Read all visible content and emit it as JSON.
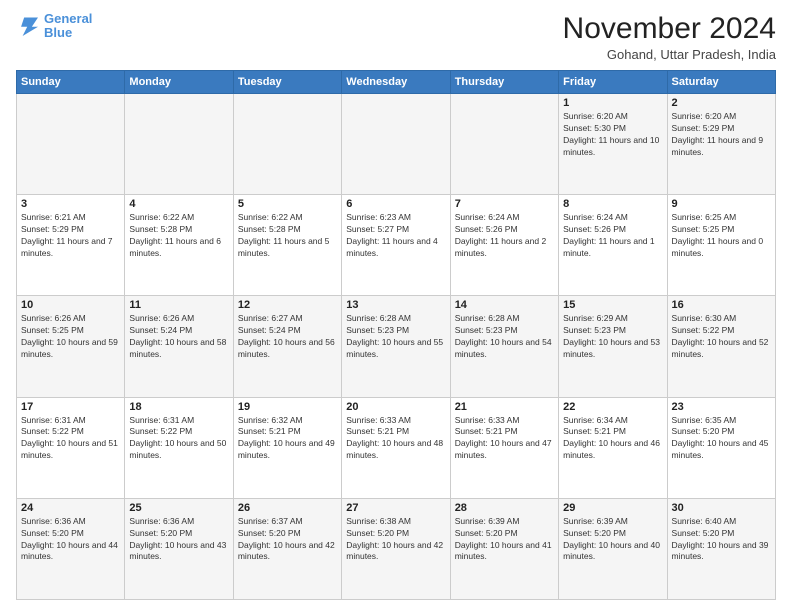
{
  "header": {
    "logo": {
      "line1": "General",
      "line2": "Blue"
    },
    "title": "November 2024",
    "location": "Gohand, Uttar Pradesh, India"
  },
  "days_of_week": [
    "Sunday",
    "Monday",
    "Tuesday",
    "Wednesday",
    "Thursday",
    "Friday",
    "Saturday"
  ],
  "weeks": [
    [
      {
        "day": "",
        "info": ""
      },
      {
        "day": "",
        "info": ""
      },
      {
        "day": "",
        "info": ""
      },
      {
        "day": "",
        "info": ""
      },
      {
        "day": "",
        "info": ""
      },
      {
        "day": "1",
        "info": "Sunrise: 6:20 AM\nSunset: 5:30 PM\nDaylight: 11 hours and 10 minutes."
      },
      {
        "day": "2",
        "info": "Sunrise: 6:20 AM\nSunset: 5:29 PM\nDaylight: 11 hours and 9 minutes."
      }
    ],
    [
      {
        "day": "3",
        "info": "Sunrise: 6:21 AM\nSunset: 5:29 PM\nDaylight: 11 hours and 7 minutes."
      },
      {
        "day": "4",
        "info": "Sunrise: 6:22 AM\nSunset: 5:28 PM\nDaylight: 11 hours and 6 minutes."
      },
      {
        "day": "5",
        "info": "Sunrise: 6:22 AM\nSunset: 5:28 PM\nDaylight: 11 hours and 5 minutes."
      },
      {
        "day": "6",
        "info": "Sunrise: 6:23 AM\nSunset: 5:27 PM\nDaylight: 11 hours and 4 minutes."
      },
      {
        "day": "7",
        "info": "Sunrise: 6:24 AM\nSunset: 5:26 PM\nDaylight: 11 hours and 2 minutes."
      },
      {
        "day": "8",
        "info": "Sunrise: 6:24 AM\nSunset: 5:26 PM\nDaylight: 11 hours and 1 minute."
      },
      {
        "day": "9",
        "info": "Sunrise: 6:25 AM\nSunset: 5:25 PM\nDaylight: 11 hours and 0 minutes."
      }
    ],
    [
      {
        "day": "10",
        "info": "Sunrise: 6:26 AM\nSunset: 5:25 PM\nDaylight: 10 hours and 59 minutes."
      },
      {
        "day": "11",
        "info": "Sunrise: 6:26 AM\nSunset: 5:24 PM\nDaylight: 10 hours and 58 minutes."
      },
      {
        "day": "12",
        "info": "Sunrise: 6:27 AM\nSunset: 5:24 PM\nDaylight: 10 hours and 56 minutes."
      },
      {
        "day": "13",
        "info": "Sunrise: 6:28 AM\nSunset: 5:23 PM\nDaylight: 10 hours and 55 minutes."
      },
      {
        "day": "14",
        "info": "Sunrise: 6:28 AM\nSunset: 5:23 PM\nDaylight: 10 hours and 54 minutes."
      },
      {
        "day": "15",
        "info": "Sunrise: 6:29 AM\nSunset: 5:23 PM\nDaylight: 10 hours and 53 minutes."
      },
      {
        "day": "16",
        "info": "Sunrise: 6:30 AM\nSunset: 5:22 PM\nDaylight: 10 hours and 52 minutes."
      }
    ],
    [
      {
        "day": "17",
        "info": "Sunrise: 6:31 AM\nSunset: 5:22 PM\nDaylight: 10 hours and 51 minutes."
      },
      {
        "day": "18",
        "info": "Sunrise: 6:31 AM\nSunset: 5:22 PM\nDaylight: 10 hours and 50 minutes."
      },
      {
        "day": "19",
        "info": "Sunrise: 6:32 AM\nSunset: 5:21 PM\nDaylight: 10 hours and 49 minutes."
      },
      {
        "day": "20",
        "info": "Sunrise: 6:33 AM\nSunset: 5:21 PM\nDaylight: 10 hours and 48 minutes."
      },
      {
        "day": "21",
        "info": "Sunrise: 6:33 AM\nSunset: 5:21 PM\nDaylight: 10 hours and 47 minutes."
      },
      {
        "day": "22",
        "info": "Sunrise: 6:34 AM\nSunset: 5:21 PM\nDaylight: 10 hours and 46 minutes."
      },
      {
        "day": "23",
        "info": "Sunrise: 6:35 AM\nSunset: 5:20 PM\nDaylight: 10 hours and 45 minutes."
      }
    ],
    [
      {
        "day": "24",
        "info": "Sunrise: 6:36 AM\nSunset: 5:20 PM\nDaylight: 10 hours and 44 minutes."
      },
      {
        "day": "25",
        "info": "Sunrise: 6:36 AM\nSunset: 5:20 PM\nDaylight: 10 hours and 43 minutes."
      },
      {
        "day": "26",
        "info": "Sunrise: 6:37 AM\nSunset: 5:20 PM\nDaylight: 10 hours and 42 minutes."
      },
      {
        "day": "27",
        "info": "Sunrise: 6:38 AM\nSunset: 5:20 PM\nDaylight: 10 hours and 42 minutes."
      },
      {
        "day": "28",
        "info": "Sunrise: 6:39 AM\nSunset: 5:20 PM\nDaylight: 10 hours and 41 minutes."
      },
      {
        "day": "29",
        "info": "Sunrise: 6:39 AM\nSunset: 5:20 PM\nDaylight: 10 hours and 40 minutes."
      },
      {
        "day": "30",
        "info": "Sunrise: 6:40 AM\nSunset: 5:20 PM\nDaylight: 10 hours and 39 minutes."
      }
    ]
  ]
}
